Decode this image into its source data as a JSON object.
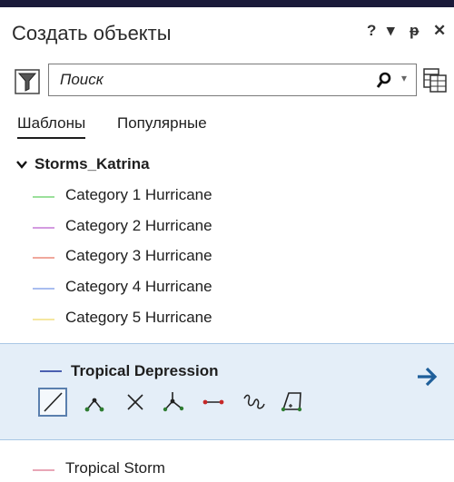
{
  "pane": {
    "title": "Создать объекты",
    "buttons": {
      "help": "?",
      "menu": "▾",
      "pin": "ᵽ",
      "close": "✕"
    }
  },
  "search": {
    "placeholder": "Поиск"
  },
  "tabs": [
    {
      "label": "Шаблоны",
      "active": true
    },
    {
      "label": "Популярные",
      "active": false
    }
  ],
  "group": {
    "name": "Storms_Katrina",
    "expanded": true
  },
  "templates": [
    {
      "label": "Category 1 Hurricane",
      "color": "#9be09b"
    },
    {
      "label": "Category 2 Hurricane",
      "color": "#d49be0"
    },
    {
      "label": "Category 3 Hurricane",
      "color": "#f0a89c"
    },
    {
      "label": "Category 4 Hurricane",
      "color": "#a9bdf0"
    },
    {
      "label": "Category 5 Hurricane",
      "color": "#f5e7a0"
    }
  ],
  "selected_template": {
    "label": "Tropical Depression",
    "color": "#4a5fb0",
    "tools": [
      "line-tool-icon",
      "right-angle-line-icon",
      "midpoint-line-icon",
      "endpoint-arc-icon",
      "trace-tool-icon",
      "freehand-icon",
      "rectangle-tool-icon"
    ],
    "active_tool": "line-tool-icon"
  },
  "last_template": {
    "label": "Tropical Storm",
    "color": "#e8a6b6"
  },
  "colors": {
    "accent": "#1f6fb8",
    "selection_bg": "#e4eef8",
    "topbar": "#1b1b3a"
  }
}
